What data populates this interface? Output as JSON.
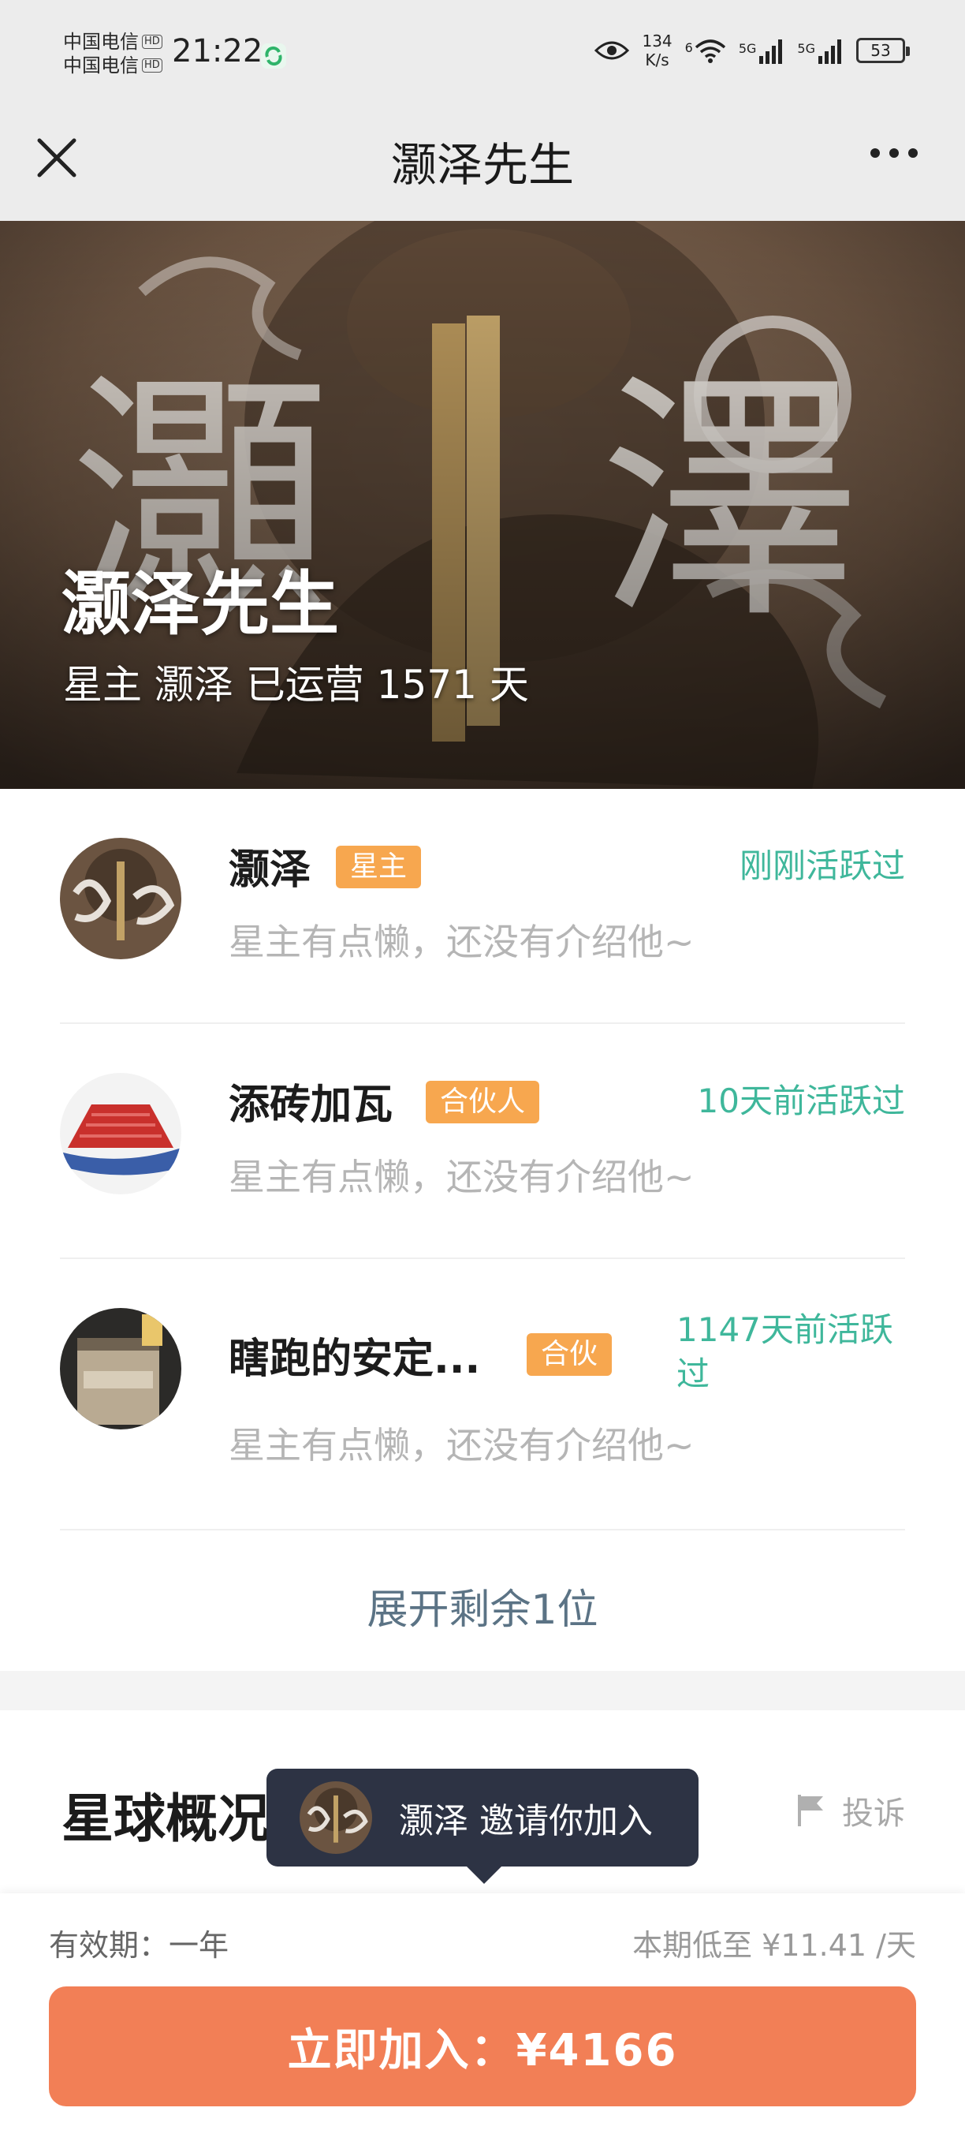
{
  "status_bar": {
    "carrier1": "中国电信",
    "carrier2": "中国电信",
    "hd_badge": "HD",
    "time": "21:22",
    "net_speed_value": "134",
    "net_speed_unit": "K/s",
    "wifi_label": "6",
    "signal1_label": "5G",
    "signal2_label": "5G",
    "battery": "53"
  },
  "nav": {
    "title": "灏泽先生"
  },
  "hero": {
    "title": "灏泽先生",
    "subtitle": "星主 灏泽 已运营 1571 天",
    "art_glyph_left": "灝",
    "art_glyph_right": "澤"
  },
  "members": [
    {
      "name": "灏泽",
      "role": "星主",
      "activity": "刚刚活跃过",
      "bio": "星主有点懒，还没有介绍他~"
    },
    {
      "name": "添砖加瓦",
      "role": "合伙人",
      "activity": "10天前活跃过",
      "bio": "星主有点懒，还没有介绍他~"
    },
    {
      "name": "瞎跑的安定...",
      "role": "合伙",
      "activity": "1147天前活跃过",
      "bio": "星主有点懒，还没有介绍他~"
    }
  ],
  "expand_more": "展开剩余1位",
  "overview": {
    "title": "星球概况",
    "report_label": "投诉"
  },
  "invite_tooltip": {
    "text": "灏泽 邀请你加入"
  },
  "footer": {
    "validity": "有效期：一年",
    "price_note": "本期低至 ¥11.41 /天",
    "join_button": "立即加入：¥4166"
  },
  "colors": {
    "accent_green": "#3fb79b",
    "role_badge": "#f7a74f",
    "join_button": "#f27f56",
    "tooltip_bg": "#2d3344"
  }
}
